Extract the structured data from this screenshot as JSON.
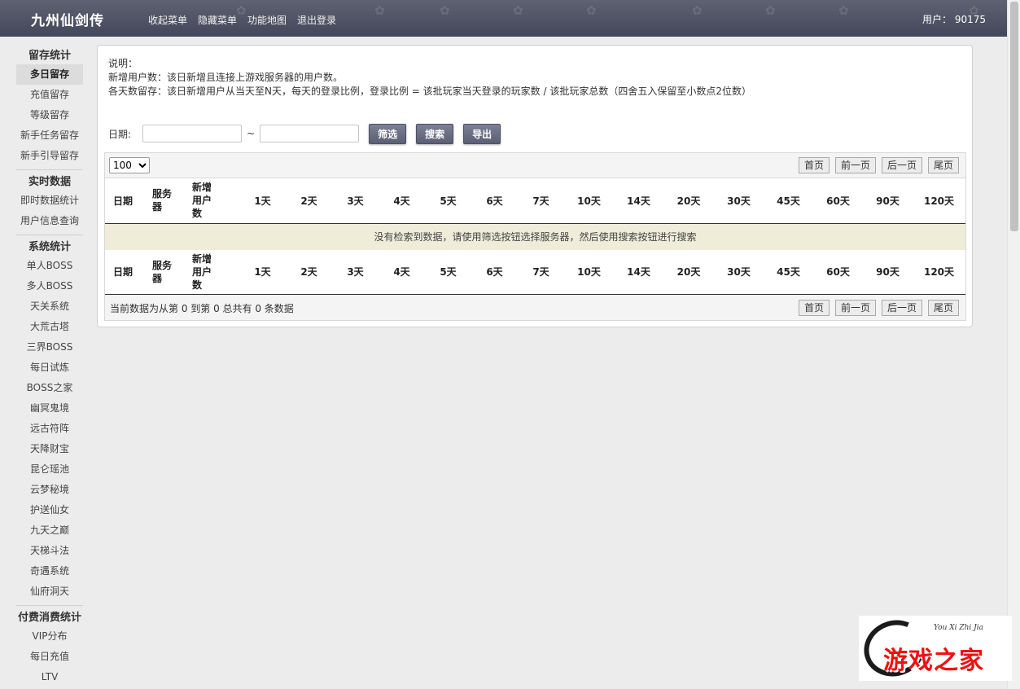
{
  "header": {
    "brand": "九州仙剑传",
    "nav": [
      "收起菜单",
      "隐藏菜单",
      "功能地图",
      "退出登录"
    ],
    "user": "用户： 90175"
  },
  "sidebar": [
    {
      "title": "留存统计",
      "items": [
        {
          "label": "多日留存",
          "active": true
        },
        {
          "label": "充值留存"
        },
        {
          "label": "等级留存"
        },
        {
          "label": "新手任务留存"
        },
        {
          "label": "新手引导留存"
        }
      ]
    },
    {
      "title": "实时数据",
      "items": [
        {
          "label": "即时数据统计"
        },
        {
          "label": "用户信息查询"
        }
      ]
    },
    {
      "title": "系统统计",
      "items": [
        {
          "label": "单人BOSS"
        },
        {
          "label": "多人BOSS"
        },
        {
          "label": "天关系统"
        },
        {
          "label": "大荒古塔"
        },
        {
          "label": "三界BOSS"
        },
        {
          "label": "每日试炼"
        },
        {
          "label": "BOSS之家"
        },
        {
          "label": "幽冥鬼境"
        },
        {
          "label": "远古符阵"
        },
        {
          "label": "天降财宝"
        },
        {
          "label": "昆仑瑶池"
        },
        {
          "label": "云梦秘境"
        },
        {
          "label": "护送仙女"
        },
        {
          "label": "九天之巅"
        },
        {
          "label": "天梯斗法"
        },
        {
          "label": "奇遇系统"
        },
        {
          "label": "仙府洞天"
        }
      ]
    },
    {
      "title": "付费消费统计",
      "items": [
        {
          "label": "VIP分布"
        },
        {
          "label": "每日充值"
        },
        {
          "label": "LTV"
        }
      ]
    }
  ],
  "description": {
    "lines": [
      "说明：",
      "新增用户数：该日新增且连接上游戏服务器的用户数。",
      "各天数留存：该日新增用户从当天至N天，每天的登录比例，登录比例 = 该批玩家当天登录的玩家数 / 该批玩家总数（四舍五入保留至小数点2位数）"
    ]
  },
  "filter": {
    "date_label": "日期:",
    "start_value": "",
    "tilde": "~",
    "end_value": "",
    "buttons": [
      "筛选",
      "搜索",
      "导出"
    ]
  },
  "table": {
    "page_size": "100",
    "page_size_options": [
      "100"
    ],
    "pager": [
      "首页",
      "前一页",
      "后一页",
      "尾页"
    ],
    "columns": [
      "日期",
      "服务器",
      "新增用户数",
      "1天",
      "2天",
      "3天",
      "4天",
      "5天",
      "6天",
      "7天",
      "10天",
      "14天",
      "20天",
      "30天",
      "45天",
      "60天",
      "90天",
      "120天"
    ],
    "empty_message": "没有检索到数据，请使用筛选按钮选择服务器，然后使用搜索按钮进行搜索",
    "footer_info": "当前数据为从第 0 到第 0 总共有 0 条数据"
  },
  "watermark": {
    "script_text": "You Xi Zhi Jia",
    "text": "游戏之家"
  }
}
